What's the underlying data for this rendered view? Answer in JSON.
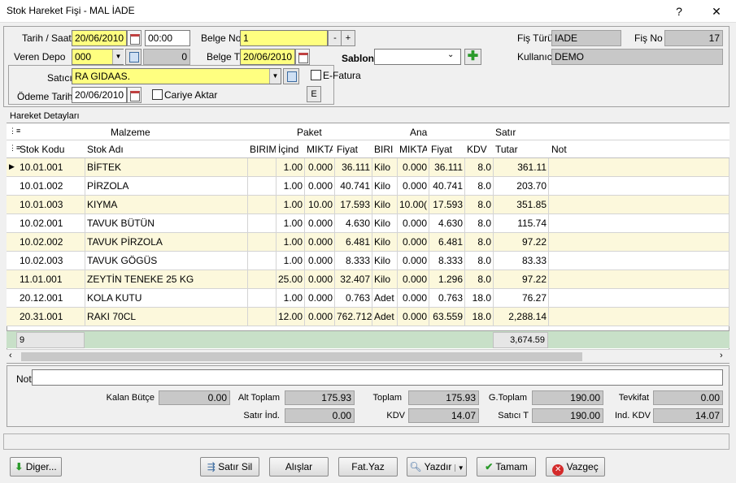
{
  "window": {
    "title": "Stok Hareket Fişi - MAL İADE",
    "help": "?",
    "close": "✕"
  },
  "header": {
    "tarih_label": "Tarih / Saat",
    "tarih": "20/06/2010",
    "saat": "00:00",
    "depo_label": "Veren Depo",
    "depo": "000",
    "depo_num": "0",
    "belge_no_label": "Belge No",
    "belge_no": "1",
    "minus": "-",
    "plus": "+",
    "belge_t_label": "Belge T.",
    "belge_t": "20/06/2010",
    "sablon_label": "Sablon",
    "sablon": "",
    "fis_turu_label": "Fiş Türü",
    "fis_turu": "IADE",
    "fis_no_label": "Fiş No",
    "fis_no": "17",
    "kullanici_label": "Kullanıcı",
    "kullanici": "DEMO",
    "satici_label": "Satıcı",
    "satici": "RA GIDAAS.",
    "efatura_label": "E-Fatura",
    "odeme_label": "Ödeme Tarihi",
    "odeme": "20/06/2010",
    "cari_label": "Cariye Aktar",
    "e_btn": "E"
  },
  "grid": {
    "section_label": "Hareket Detayları",
    "group_headers": [
      "Malzeme",
      "Paket",
      "Ana",
      "Satır"
    ],
    "columns": [
      "Stok Kodu",
      "Stok Adı",
      "BIRIM",
      "İçind",
      "MIKTA",
      "Fiyat",
      "BIRI",
      "MIKTA",
      "Fiyat",
      "KDV",
      "Tutar",
      "Not"
    ],
    "rows": [
      [
        "10.01.001",
        "BİFTEK",
        "",
        "1.00",
        "0.000",
        "36.111",
        "Kilo",
        "0.000",
        "36.111",
        "8.0",
        "361.11",
        ""
      ],
      [
        "10.01.002",
        "PİRZOLA",
        "",
        "1.00",
        "0.000",
        "40.741",
        "Kilo",
        "0.000",
        "40.741",
        "8.0",
        "203.70",
        ""
      ],
      [
        "10.01.003",
        "KIYMA",
        "",
        "1.00",
        "10.00",
        "17.593",
        "Kilo",
        "10.00(",
        "17.593",
        "8.0",
        "351.85",
        ""
      ],
      [
        "10.02.001",
        "TAVUK BÜTÜN",
        "",
        "1.00",
        "0.000",
        "4.630",
        "Kilo",
        "0.000",
        "4.630",
        "8.0",
        "115.74",
        ""
      ],
      [
        "10.02.002",
        "TAVUK PİRZOLA",
        "",
        "1.00",
        "0.000",
        "6.481",
        "Kilo",
        "0.000",
        "6.481",
        "8.0",
        "97.22",
        ""
      ],
      [
        "10.02.003",
        "TAVUK GÖGÜS",
        "",
        "1.00",
        "0.000",
        "8.333",
        "Kilo",
        "0.000",
        "8.333",
        "8.0",
        "83.33",
        ""
      ],
      [
        "11.01.001",
        "ZEYTİN TENEKE 25 KG",
        "",
        "25.00",
        "0.000",
        "32.407",
        "Kilo",
        "0.000",
        "1.296",
        "8.0",
        "97.22",
        ""
      ],
      [
        "20.12.001",
        "KOLA KUTU",
        "",
        "1.00",
        "0.000",
        "0.763",
        "Adet",
        "0.000",
        "0.763",
        "18.0",
        "76.27",
        ""
      ],
      [
        "20.31.001",
        "RAKI 70CL",
        "",
        "12.00",
        "0.000",
        "762.712",
        "Adet",
        "0.000",
        "63.559",
        "18.0",
        "2,288.14",
        ""
      ]
    ],
    "footer_count": "9",
    "footer_total": "3,674.59"
  },
  "not_label": "Not",
  "not_value": "",
  "summary": {
    "kalan_butce_label": "Kalan Bütçe",
    "kalan_butce": "0.00",
    "alt_toplam_label": "Alt Toplam",
    "alt_toplam": "175.93",
    "toplam_label": "Toplam",
    "toplam": "175.93",
    "g_toplam_label": "G.Toplam",
    "g_toplam": "190.00",
    "tevkifat_label": "Tevkifat",
    "tevkifat": "0.00",
    "satir_ind_label": "Satır İnd.",
    "satir_ind": "0.00",
    "kdv_label": "KDV",
    "kdv": "14.07",
    "satici_t_label": "Satıcı T",
    "satici_t": "190.00",
    "ind_kdv_label": "Ind. KDV",
    "ind_kdv": "14.07"
  },
  "buttons": {
    "diger": "Diger...",
    "satir_sil": "Satır Sil",
    "alislar": "Alışlar",
    "fat_yaz": "Fat.Yaz",
    "yazdir": "Yazdır",
    "tamam": "Tamam",
    "vazgec": "Vazgeç"
  }
}
